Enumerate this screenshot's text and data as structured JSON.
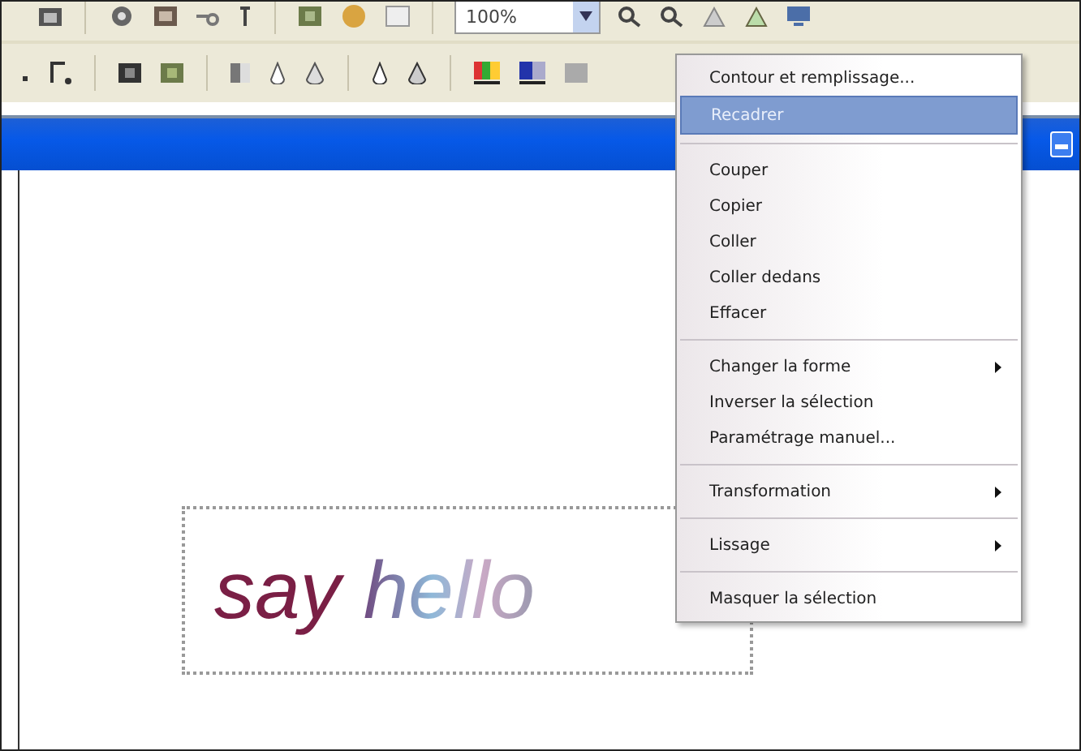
{
  "zoom_field": {
    "value": "100%"
  },
  "document": {
    "text_1": "say",
    "text_2": "hello"
  },
  "context_menu": {
    "groups": [
      [
        {
          "label": "Contour et remplissage...",
          "selected": false,
          "submenu": false
        },
        {
          "label": "Recadrer",
          "selected": true,
          "submenu": false
        }
      ],
      [
        {
          "label": "Couper",
          "selected": false,
          "submenu": false
        },
        {
          "label": "Copier",
          "selected": false,
          "submenu": false
        },
        {
          "label": "Coller",
          "selected": false,
          "submenu": false
        },
        {
          "label": "Coller dedans",
          "selected": false,
          "submenu": false
        },
        {
          "label": "Effacer",
          "selected": false,
          "submenu": false
        }
      ],
      [
        {
          "label": "Changer la forme",
          "selected": false,
          "submenu": true
        },
        {
          "label": "Inverser la sélection",
          "selected": false,
          "submenu": false
        },
        {
          "label": "Paramétrage manuel...",
          "selected": false,
          "submenu": false
        }
      ],
      [
        {
          "label": "Transformation",
          "selected": false,
          "submenu": true
        }
      ],
      [
        {
          "label": "Lissage",
          "selected": false,
          "submenu": true
        }
      ],
      [
        {
          "label": "Masquer la sélection",
          "selected": false,
          "submenu": false
        }
      ]
    ]
  }
}
